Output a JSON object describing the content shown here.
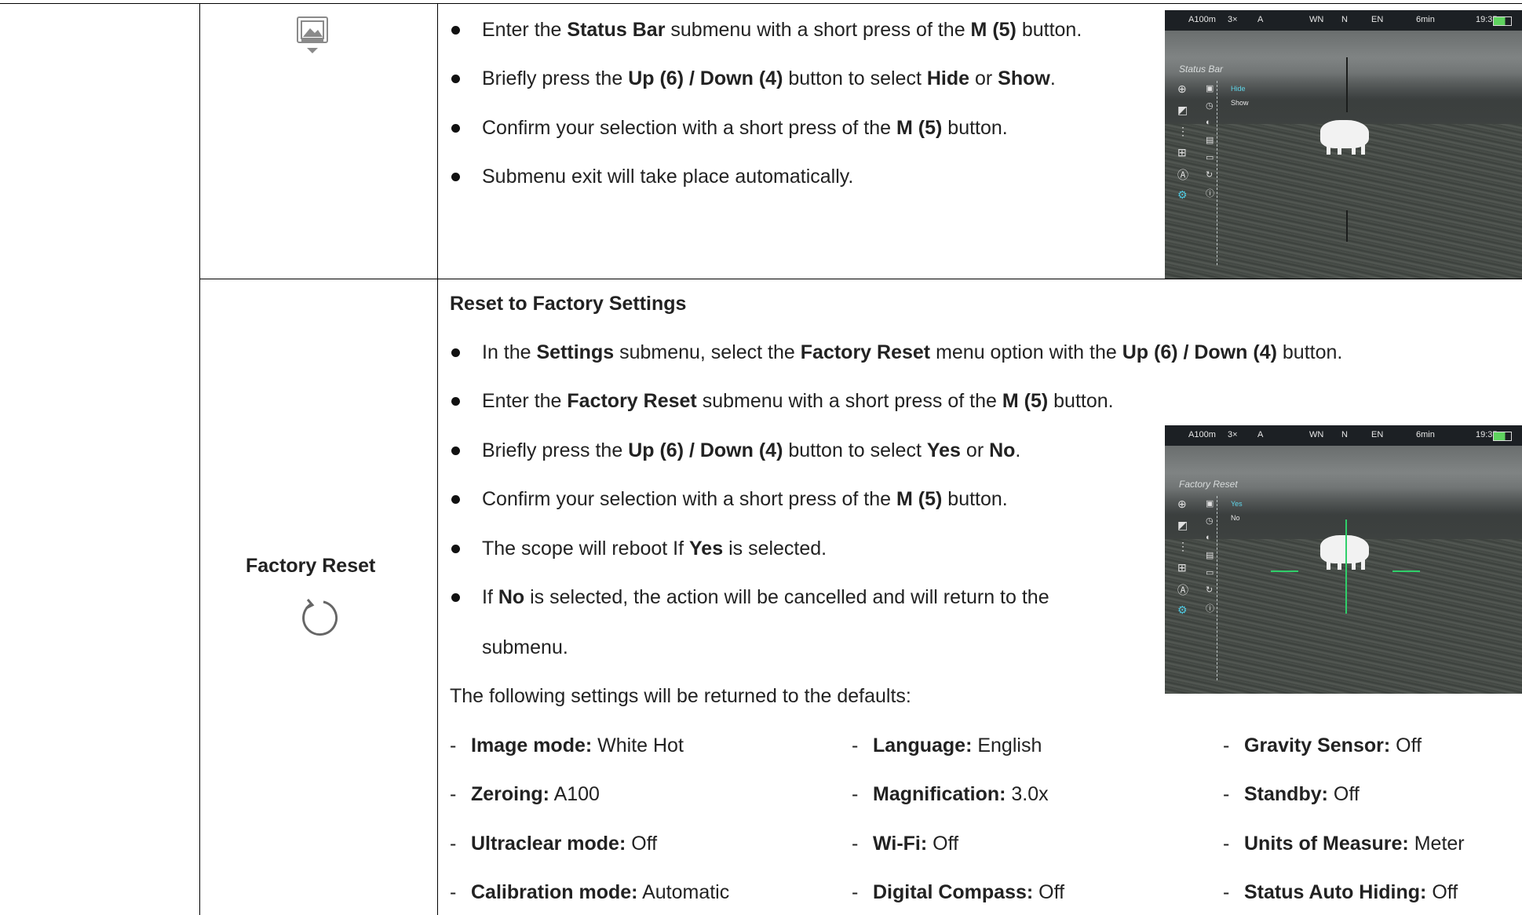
{
  "status_bar_row": {
    "bullets": [
      [
        {
          "t": "Enter the "
        },
        {
          "b": "Status Bar"
        },
        {
          "t": " submenu with a short press of the "
        },
        {
          "b": "M (5)"
        },
        {
          "t": " button."
        }
      ],
      [
        {
          "t": "Briefly press the "
        },
        {
          "b": "Up (6) / Down (4)"
        },
        {
          "t": " button to select "
        },
        {
          "b": "Hide"
        },
        {
          "t": " or "
        },
        {
          "b": "Show"
        },
        {
          "t": "."
        }
      ],
      [
        {
          "t": "Confirm your selection with a short press of the "
        },
        {
          "b": "M (5)"
        },
        {
          "t": " button."
        }
      ],
      [
        {
          "t": "Submenu exit will take place automatically."
        }
      ]
    ],
    "screen": {
      "status": [
        "A100m",
        "3×",
        "A",
        "WN",
        "N",
        "EN",
        "6min",
        "19:35"
      ],
      "title": "Status Bar",
      "options": [
        "Hide",
        "Show"
      ]
    }
  },
  "factory_reset_row": {
    "left_label": "Factory Reset",
    "heading": "Reset to Factory Settings",
    "bullets": [
      [
        {
          "t": "In the "
        },
        {
          "b": "Settings"
        },
        {
          "t": " submenu, select the "
        },
        {
          "b": "Factory Reset"
        },
        {
          "t": " menu option with the "
        },
        {
          "b": "Up (6) / Down (4)"
        },
        {
          "t": " button."
        }
      ],
      [
        {
          "t": "Enter the "
        },
        {
          "b": "Factory Reset"
        },
        {
          "t": " submenu with a short press of the "
        },
        {
          "b": "M (5)"
        },
        {
          "t": " button."
        }
      ],
      [
        {
          "t": "Briefly press the "
        },
        {
          "b": "Up (6) / Down (4)"
        },
        {
          "t": " button to select "
        },
        {
          "b": "Yes"
        },
        {
          "t": " or "
        },
        {
          "b": "No"
        },
        {
          "t": "."
        }
      ],
      [
        {
          "t": "Confirm your selection with a short press of the "
        },
        {
          "b": "M (5)"
        },
        {
          "t": " button."
        }
      ],
      [
        {
          "t": "The scope will reboot If "
        },
        {
          "b": "Yes"
        },
        {
          "t": " is selected."
        }
      ],
      [
        {
          "t": "If "
        },
        {
          "b": "No"
        },
        {
          "t": " is selected, the action will be cancelled and will return to the"
        }
      ]
    ],
    "bullet_continuation": "submenu.",
    "defaults_intro": "The following settings will be returned to the defaults:",
    "defaults": [
      [
        {
          "k": "Image mode:",
          "v": " White Hot"
        },
        {
          "k": "Language:",
          "v": " English"
        },
        {
          "k": "Gravity Sensor:",
          "v": " Off"
        }
      ],
      [
        {
          "k": "Zeroing:",
          "v": " A100"
        },
        {
          "k": "Magnification:",
          "v": " 3.0x"
        },
        {
          "k": "Standby:",
          "v": " Off"
        }
      ],
      [
        {
          "k": "Ultraclear mode:",
          "v": " Off"
        },
        {
          "k": "Wi-Fi:",
          "v": " Off"
        },
        {
          "k": "Units of Measure:",
          "v": " Meter"
        }
      ],
      [
        {
          "k": "Calibration mode:",
          "v": " Automatic"
        },
        {
          "k": "Digital Compass:",
          "v": " Off"
        },
        {
          "k": "Status Auto Hiding:",
          "v": " Off"
        }
      ]
    ],
    "screen": {
      "status": [
        "A100m",
        "3×",
        "A",
        "WN",
        "N",
        "EN",
        "6min",
        "19:35"
      ],
      "title": "Factory Reset",
      "options": [
        "Yes",
        "No"
      ]
    }
  }
}
